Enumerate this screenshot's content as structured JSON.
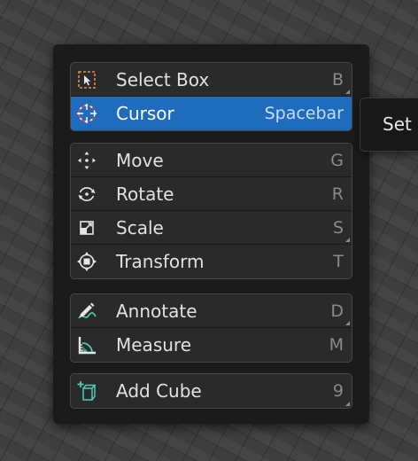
{
  "menu": {
    "groups": [
      {
        "items": [
          {
            "label": "Select Box",
            "shortcut": "B",
            "icon": "select-box-icon",
            "active": false,
            "has_submenu": true
          },
          {
            "label": "Cursor",
            "shortcut": "Spacebar",
            "icon": "cursor-icon",
            "active": true,
            "has_submenu": false
          }
        ]
      },
      {
        "items": [
          {
            "label": "Move",
            "shortcut": "G",
            "icon": "move-icon",
            "active": false,
            "has_submenu": false
          },
          {
            "label": "Rotate",
            "shortcut": "R",
            "icon": "rotate-icon",
            "active": false,
            "has_submenu": false
          },
          {
            "label": "Scale",
            "shortcut": "S",
            "icon": "scale-icon",
            "active": false,
            "has_submenu": true
          },
          {
            "label": "Transform",
            "shortcut": "T",
            "icon": "transform-icon",
            "active": false,
            "has_submenu": false
          }
        ]
      },
      {
        "items": [
          {
            "label": "Annotate",
            "shortcut": "D",
            "icon": "annotate-icon",
            "active": false,
            "has_submenu": true
          },
          {
            "label": "Measure",
            "shortcut": "M",
            "icon": "measure-icon",
            "active": false,
            "has_submenu": false
          }
        ]
      },
      {
        "items": [
          {
            "label": "Add Cube",
            "shortcut": "9",
            "icon": "add-cube-icon",
            "active": false,
            "has_submenu": true
          }
        ]
      }
    ]
  },
  "tooltip": {
    "text": "Set"
  },
  "colors": {
    "highlight": "#1f6bbd",
    "menu_bg": "#1b1b1b",
    "item_bg": "#2a2a2a",
    "text": "#e1e1e1",
    "shortcut_text": "#8a8a8a",
    "icon_accent_orange": "#e0913a",
    "icon_accent_teal": "#49d0b5"
  }
}
